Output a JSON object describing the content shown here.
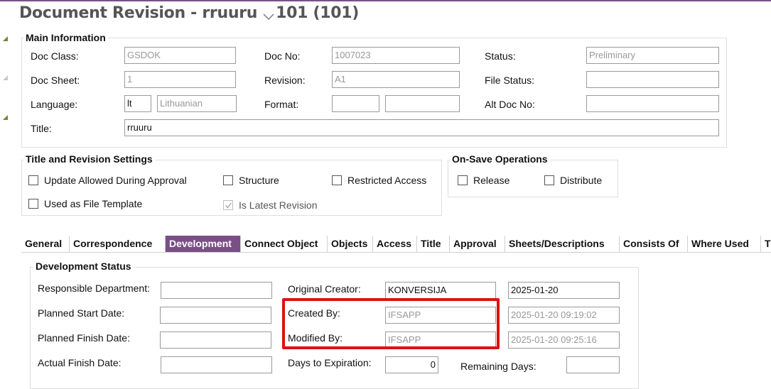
{
  "header": {
    "title": "Document Revision - rruuru",
    "record": "101 (101)"
  },
  "main_info": {
    "title": "Main Information",
    "doc_class": {
      "label": "Doc Class:",
      "value": "GSDOK"
    },
    "doc_no": {
      "label": "Doc No:",
      "value": "1007023"
    },
    "status": {
      "label": "Status:",
      "value": "Preliminary"
    },
    "doc_sheet": {
      "label": "Doc Sheet:",
      "value": "1"
    },
    "revision": {
      "label": "Revision:",
      "value": "A1"
    },
    "file_status": {
      "label": "File Status:",
      "value": ""
    },
    "language": {
      "label": "Language:",
      "code": "lt",
      "name": "Lithuanian"
    },
    "format": {
      "label": "Format:",
      "value1": "",
      "value2": ""
    },
    "alt_doc_no": {
      "label": "Alt Doc No:",
      "value": ""
    },
    "doc_title": {
      "label": "Title:",
      "value": "rruuru"
    }
  },
  "revision_settings": {
    "title": "Title and Revision Settings",
    "update_allowed": {
      "label": "Update Allowed During Approval",
      "checked": false
    },
    "structure": {
      "label": "Structure",
      "checked": false
    },
    "restricted_access": {
      "label": "Restricted Access",
      "checked": false
    },
    "file_template": {
      "label": "Used as File Template",
      "checked": false
    },
    "latest_revision": {
      "label": "Is Latest Revision",
      "checked": true
    }
  },
  "on_save": {
    "title": "On-Save Operations",
    "release": {
      "label": "Release",
      "checked": false
    },
    "distribute": {
      "label": "Distribute",
      "checked": false
    }
  },
  "tabs": [
    "General",
    "Correspondence",
    "Development",
    "Connect Object",
    "Objects",
    "Access",
    "Title",
    "Approval",
    "Sheets/Descriptions",
    "Consists Of",
    "Where Used",
    "T"
  ],
  "active_tab": "Development",
  "development": {
    "title": "Development Status",
    "responsible_department": {
      "label": "Responsible Department:",
      "value": ""
    },
    "planned_start": {
      "label": "Planned Start Date:",
      "value": ""
    },
    "planned_finish": {
      "label": "Planned Finish Date:",
      "value": ""
    },
    "actual_finish": {
      "label": "Actual Finish Date:",
      "value": ""
    },
    "original_creator": {
      "label": "Original Creator:",
      "value": "KONVERSIJA",
      "date": "2025-01-20"
    },
    "created_by": {
      "label": "Created By:",
      "value": "IFSAPP",
      "date": "2025-01-20 09:19:02"
    },
    "modified_by": {
      "label": "Modified By:",
      "value": "IFSAPP",
      "date": "2025-01-20 09:25:16"
    },
    "days_to_expiration": {
      "label": "Days to Expiration:",
      "value": "0"
    },
    "remaining_days": {
      "label": "Remaining Days:",
      "value": ""
    }
  },
  "colors": {
    "accent": "#7a4f86",
    "highlight": "#e01010",
    "section_marker": "#6c8a2e"
  }
}
